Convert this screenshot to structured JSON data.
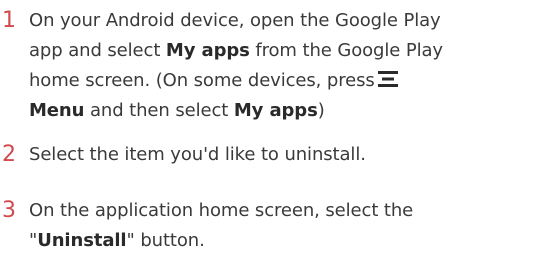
{
  "steps": [
    {
      "number": "1",
      "line1": "On your Android device, open the Google Play",
      "line2_a": "app and select ",
      "line2_b": "My apps",
      "line2_c": " from the Google Play",
      "line3_a": "home screen. (On some devices, press",
      "menu_icon": "menu-icon",
      "line4_a": "Menu",
      "line4_b": " and then select ",
      "line4_c": "My apps",
      "line4_d": ")"
    },
    {
      "number": "2",
      "text": "Select the item you'd like to uninstall."
    },
    {
      "number": "3",
      "line1": "On the application home screen, select the",
      "line2_a": "\"",
      "line2_b": "Uninstall",
      "line2_c": "\" button."
    }
  ],
  "colors": {
    "step_number": "#d04a4e",
    "text": "#3a3a3a"
  }
}
